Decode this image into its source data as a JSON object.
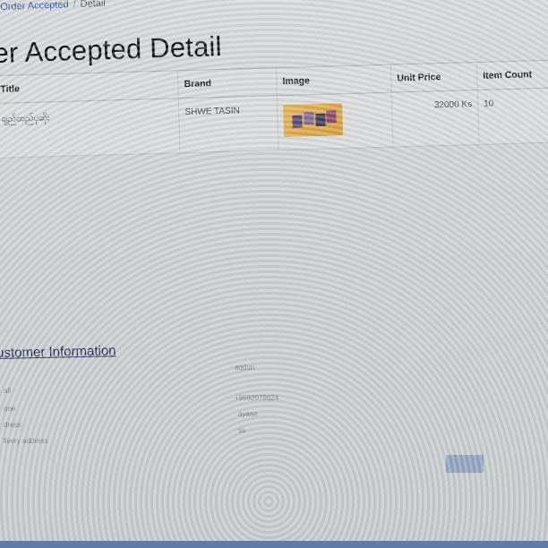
{
  "breadcrumb": {
    "link": "Order Accepted",
    "separator": "/",
    "current": "Detail"
  },
  "page_title": "er Accepted Detail",
  "table": {
    "headers": [
      "Title",
      "Brand",
      "Image",
      "Unit Price",
      "Item Count"
    ],
    "rows": [
      {
        "title": "ချည်ထည်ပုဆိုး",
        "brand": "SHWE TASIN",
        "image": "product-thumbnail",
        "unit_price": "32000 Ks",
        "item_count": "10"
      }
    ]
  },
  "customer": {
    "section_title": "ustomer Information",
    "labels": [
      "ail",
      "one",
      "dress",
      "livery address"
    ],
    "values": [
      "aqdun",
      "+9592078624",
      "ayaae",
      "ss"
    ]
  },
  "colors": {
    "breadcrumb_link": "#2a4fb0",
    "section_title": "#1c2a55",
    "submit_button": "#7d97b8"
  }
}
